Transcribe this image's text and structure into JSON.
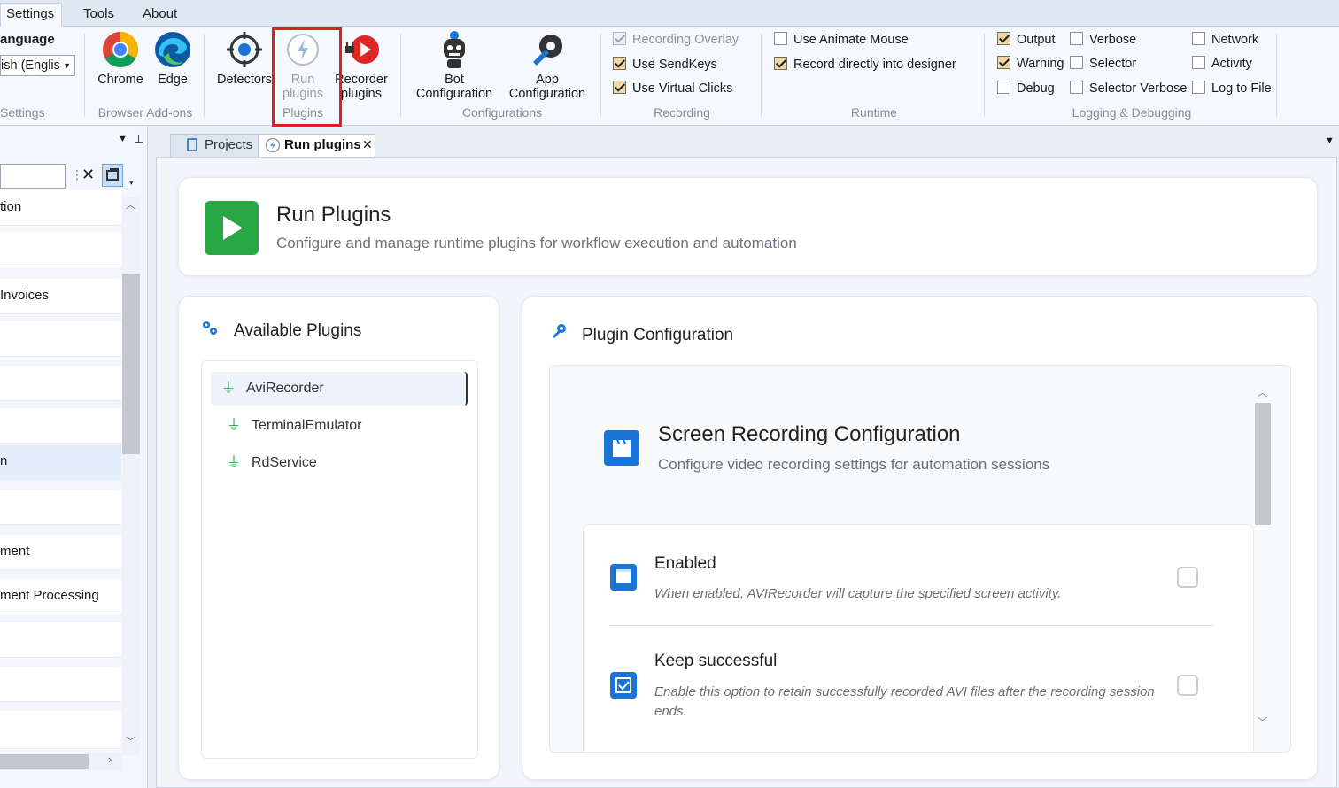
{
  "menu": {
    "tabs": [
      "Settings",
      "Tools",
      "About"
    ]
  },
  "ribbon": {
    "settings_group": {
      "language_label": "anguage",
      "language_value": "ish (Englis",
      "group_label": "Settings"
    },
    "browser_addons": {
      "chrome": "Chrome",
      "edge": "Edge",
      "group_label": "Browser Add-ons"
    },
    "plugins_group": {
      "detectors": "Detectors",
      "run_plugins_1": "Run",
      "run_plugins_2": "plugins",
      "recorder_plugins_1": "Recorder",
      "recorder_plugins_2": "plugins",
      "group_label": "Plugins"
    },
    "configurations": {
      "bot_1": "Bot",
      "bot_2": "Configuration",
      "app_1": "App",
      "app_2": "Configuration",
      "group_label": "Configurations"
    },
    "recording": {
      "recording_overlay": "Recording Overlay",
      "use_sendkeys": "Use SendKeys",
      "use_virtual_clicks": "Use Virtual Clicks",
      "group_label": "Recording"
    },
    "runtime": {
      "use_animate_mouse": "Use Animate Mouse",
      "record_into_designer": "Record directly into designer",
      "group_label": "Runtime"
    },
    "logging": {
      "output": "Output",
      "warning": "Warning",
      "debug": "Debug",
      "verbose": "Verbose",
      "selector": "Selector",
      "selector_verbose": "Selector Verbose",
      "network": "Network",
      "activity": "Activity",
      "log_to_file": "Log to File",
      "group_label": "Logging & Debugging"
    }
  },
  "left_panel": {
    "items": [
      "tion",
      "",
      "Invoices",
      "",
      "",
      "",
      "n",
      "",
      "ment",
      "ment Processing",
      "",
      "",
      ""
    ]
  },
  "doc_tabs": {
    "projects": "Projects",
    "run_plugins": "Run plugins"
  },
  "header": {
    "title": "Run Plugins",
    "subtitle": "Configure and manage runtime plugins for workflow execution and automation"
  },
  "available_plugins": {
    "title": "Available Plugins",
    "items": [
      "AviRecorder",
      "TerminalEmulator",
      "RdService"
    ]
  },
  "plugin_configuration": {
    "title": "Plugin Configuration",
    "section_title": "Screen Recording Configuration",
    "section_subtitle": "Configure video recording settings for automation sessions",
    "options": [
      {
        "title": "Enabled",
        "description": "When enabled, AVIRecorder will capture the specified screen activity."
      },
      {
        "title": "Keep successful",
        "description": "Enable this option to retain successfully recorded AVI files after the recording session ends."
      }
    ]
  },
  "colors": {
    "accent_blue": "#1a73d6",
    "run_green": "#28a745",
    "highlight_red": "#e01f1f"
  }
}
